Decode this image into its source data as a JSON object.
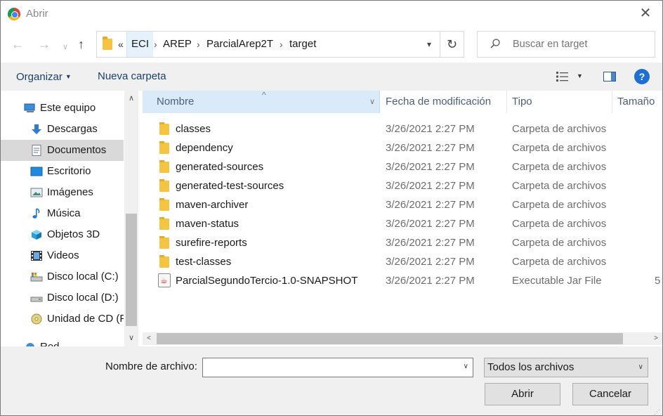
{
  "window": {
    "title": "Abrir",
    "app_icon": "chrome-icon"
  },
  "nav": {
    "breadcrumbs": [
      "ECI",
      "AREP",
      "ParcialArep2T",
      "target"
    ],
    "overflow_glyph": "«",
    "search_placeholder": "Buscar en target"
  },
  "toolbar": {
    "organize_label": "Organizar",
    "new_folder_label": "Nueva carpeta"
  },
  "sidebar": {
    "items": [
      {
        "label": "Este equipo",
        "icon": "computer-icon"
      },
      {
        "label": "Descargas",
        "icon": "download-icon"
      },
      {
        "label": "Documentos",
        "icon": "document-icon",
        "selected": true
      },
      {
        "label": "Escritorio",
        "icon": "desktop-icon"
      },
      {
        "label": "Imágenes",
        "icon": "pictures-icon"
      },
      {
        "label": "Música",
        "icon": "music-icon"
      },
      {
        "label": "Objetos 3D",
        "icon": "objects-3d-icon"
      },
      {
        "label": "Videos",
        "icon": "videos-icon"
      },
      {
        "label": "Disco local (C:)",
        "icon": "drive-c-icon"
      },
      {
        "label": "Disco local (D:)",
        "icon": "drive-d-icon"
      },
      {
        "label": "Unidad de CD (F",
        "icon": "cd-drive-icon"
      },
      {
        "label": "Red",
        "icon": "network-icon"
      }
    ]
  },
  "columns": {
    "name": "Nombre",
    "date": "Fecha de modificación",
    "type": "Tipo",
    "size": "Tamaño"
  },
  "files": [
    {
      "name": "classes",
      "date": "3/26/2021 2:27 PM",
      "type": "Carpeta de archivos",
      "size": "",
      "icon": "folder-icon"
    },
    {
      "name": "dependency",
      "date": "3/26/2021 2:27 PM",
      "type": "Carpeta de archivos",
      "size": "",
      "icon": "folder-icon"
    },
    {
      "name": "generated-sources",
      "date": "3/26/2021 2:27 PM",
      "type": "Carpeta de archivos",
      "size": "",
      "icon": "folder-icon"
    },
    {
      "name": "generated-test-sources",
      "date": "3/26/2021 2:27 PM",
      "type": "Carpeta de archivos",
      "size": "",
      "icon": "folder-icon"
    },
    {
      "name": "maven-archiver",
      "date": "3/26/2021 2:27 PM",
      "type": "Carpeta de archivos",
      "size": "",
      "icon": "folder-icon"
    },
    {
      "name": "maven-status",
      "date": "3/26/2021 2:27 PM",
      "type": "Carpeta de archivos",
      "size": "",
      "icon": "folder-icon"
    },
    {
      "name": "surefire-reports",
      "date": "3/26/2021 2:27 PM",
      "type": "Carpeta de archivos",
      "size": "",
      "icon": "folder-icon"
    },
    {
      "name": "test-classes",
      "date": "3/26/2021 2:27 PM",
      "type": "Carpeta de archivos",
      "size": "",
      "icon": "folder-icon"
    },
    {
      "name": "ParcialSegundoTercio-1.0-SNAPSHOT",
      "date": "3/26/2021 2:27 PM",
      "type": "Executable Jar File",
      "size": "5",
      "icon": "jar-icon"
    }
  ],
  "footer": {
    "filename_label": "Nombre de archivo:",
    "filename_value": "",
    "filter_value": "Todos los archivos",
    "open_label": "Abrir",
    "cancel_label": "Cancelar"
  }
}
